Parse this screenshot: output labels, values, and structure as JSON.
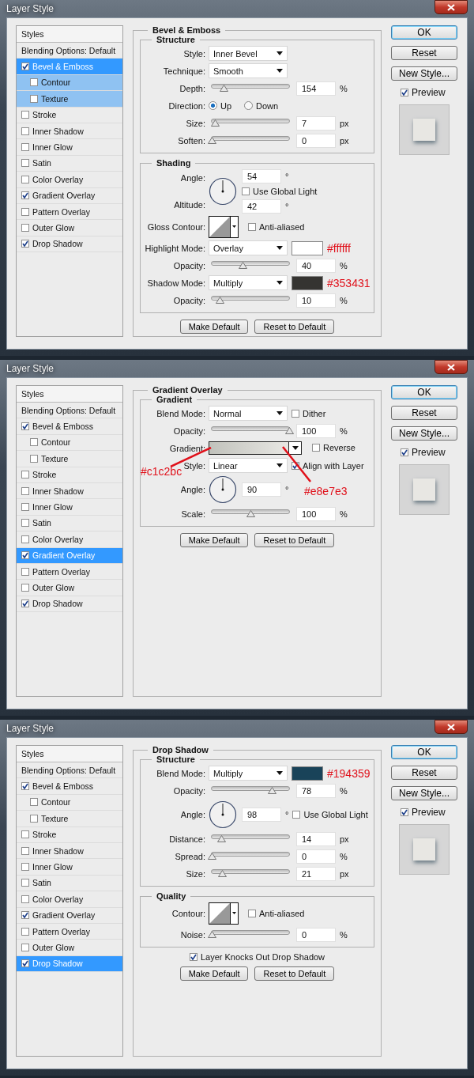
{
  "dialogs": [
    {
      "title": "Layer Style",
      "styles_header": "Styles",
      "styles": [
        {
          "label": "Blending Options: Default",
          "kind": "header",
          "selected": false
        },
        {
          "label": "Bevel & Emboss",
          "kind": "effect",
          "checked": true,
          "selected": true,
          "children": [
            {
              "label": "Contour",
              "checked": false
            },
            {
              "label": "Texture",
              "checked": false
            }
          ]
        },
        {
          "label": "Stroke",
          "kind": "effect",
          "checked": false,
          "selected": false
        },
        {
          "label": "Inner Shadow",
          "kind": "effect",
          "checked": false,
          "selected": false
        },
        {
          "label": "Inner Glow",
          "kind": "effect",
          "checked": false,
          "selected": false
        },
        {
          "label": "Satin",
          "kind": "effect",
          "checked": false,
          "selected": false
        },
        {
          "label": "Color Overlay",
          "kind": "effect",
          "checked": false,
          "selected": false
        },
        {
          "label": "Gradient Overlay",
          "kind": "effect",
          "checked": true,
          "selected": false
        },
        {
          "label": "Pattern Overlay",
          "kind": "effect",
          "checked": false,
          "selected": false
        },
        {
          "label": "Outer Glow",
          "kind": "effect",
          "checked": false,
          "selected": false
        },
        {
          "label": "Drop Shadow",
          "kind": "effect",
          "checked": true,
          "selected": false
        }
      ],
      "panel": {
        "title": "Bevel & Emboss",
        "groups": [
          {
            "title": "Structure",
            "rows": [
              {
                "kind": "select",
                "label": "Style:",
                "value": "Inner Bevel"
              },
              {
                "kind": "select",
                "label": "Technique:",
                "value": "Smooth"
              },
              {
                "kind": "slider",
                "label": "Depth:",
                "level": 0.15,
                "value": "154",
                "unit": "%"
              },
              {
                "kind": "radio",
                "label": "Direction:",
                "options": [
                  {
                    "label": "Up",
                    "selected": true
                  },
                  {
                    "label": "Down",
                    "selected": false
                  }
                ]
              },
              {
                "kind": "slider",
                "label": "Size:",
                "level": 0.04,
                "value": "7",
                "unit": "px"
              },
              {
                "kind": "slider",
                "label": "Soften:",
                "level": 0,
                "value": "0",
                "unit": "px"
              }
            ]
          },
          {
            "title": "Shading",
            "rows": [
              {
                "kind": "angle",
                "label": "Angle:",
                "value": "54",
                "unit": "°",
                "checkbox": {
                  "label": "Use Global Light",
                  "checked": false
                },
                "altitude": {
                  "label": "Altitude:",
                  "value": "42",
                  "unit": "°"
                }
              },
              {
                "kind": "contour",
                "label": "Gloss Contour:",
                "checkbox": {
                  "label": "Anti-aliased",
                  "checked": false
                }
              },
              {
                "kind": "select",
                "label": "Highlight Mode:",
                "value": "Overlay",
                "color": "#ffffff",
                "note": "#ffffff"
              },
              {
                "kind": "slider",
                "label": "Opacity:",
                "level": 0.4,
                "value": "40",
                "unit": "%"
              },
              {
                "kind": "select",
                "label": "Shadow Mode:",
                "value": "Multiply",
                "color": "#353431",
                "note": "#353431"
              },
              {
                "kind": "slider",
                "label": "Opacity:",
                "level": 0.1,
                "value": "10",
                "unit": "%"
              }
            ]
          }
        ],
        "buttons": [
          "Make Default",
          "Reset to Default"
        ]
      },
      "actions": [
        {
          "label": "OK",
          "default": true
        },
        {
          "label": "Reset",
          "default": false
        },
        {
          "label": "New Style...",
          "default": false
        }
      ],
      "preview": {
        "label": "Preview",
        "checked": true
      }
    },
    {
      "title": "Layer Style",
      "styles_header": "Styles",
      "styles": [
        {
          "label": "Blending Options: Default",
          "kind": "header",
          "selected": false
        },
        {
          "label": "Bevel & Emboss",
          "kind": "effect",
          "checked": true,
          "selected": false,
          "children": [
            {
              "label": "Contour",
              "checked": false
            },
            {
              "label": "Texture",
              "checked": false
            }
          ]
        },
        {
          "label": "Stroke",
          "kind": "effect",
          "checked": false,
          "selected": false
        },
        {
          "label": "Inner Shadow",
          "kind": "effect",
          "checked": false,
          "selected": false
        },
        {
          "label": "Inner Glow",
          "kind": "effect",
          "checked": false,
          "selected": false
        },
        {
          "label": "Satin",
          "kind": "effect",
          "checked": false,
          "selected": false
        },
        {
          "label": "Color Overlay",
          "kind": "effect",
          "checked": false,
          "selected": false
        },
        {
          "label": "Gradient Overlay",
          "kind": "effect",
          "checked": true,
          "selected": true
        },
        {
          "label": "Pattern Overlay",
          "kind": "effect",
          "checked": false,
          "selected": false
        },
        {
          "label": "Outer Glow",
          "kind": "effect",
          "checked": false,
          "selected": false
        },
        {
          "label": "Drop Shadow",
          "kind": "effect",
          "checked": true,
          "selected": false
        }
      ],
      "panel": {
        "title": "Gradient Overlay",
        "groups": [
          {
            "title": "Gradient",
            "rows": [
              {
                "kind": "select",
                "label": "Blend Mode:",
                "value": "Normal",
                "checkbox": {
                  "label": "Dither",
                  "checked": false
                }
              },
              {
                "kind": "slider",
                "label": "Opacity:",
                "level": 1,
                "value": "100",
                "unit": "%"
              },
              {
                "kind": "gradient",
                "label": "Gradient:",
                "stops": [
                  {
                    "color": "#c1c2bc",
                    "note": "#c1c2bc"
                  },
                  {
                    "color": "#e8e7e3",
                    "note": "#e8e7e3"
                  }
                ],
                "checkbox": {
                  "label": "Reverse",
                  "checked": false
                }
              },
              {
                "kind": "select",
                "label": "Style:",
                "value": "Linear",
                "checkbox": {
                  "label": "Align with Layer",
                  "checked": true
                }
              },
              {
                "kind": "angle",
                "label": "Angle:",
                "value": "90",
                "unit": "°"
              },
              {
                "kind": "slider",
                "label": "Scale:",
                "level": 0.5,
                "value": "100",
                "unit": "%"
              }
            ]
          }
        ],
        "buttons": [
          "Make Default",
          "Reset to Default"
        ]
      },
      "actions": [
        {
          "label": "OK",
          "default": true
        },
        {
          "label": "Reset",
          "default": false
        },
        {
          "label": "New Style...",
          "default": false
        }
      ],
      "preview": {
        "label": "Preview",
        "checked": true
      }
    },
    {
      "title": "Layer Style",
      "styles_header": "Styles",
      "styles": [
        {
          "label": "Blending Options: Default",
          "kind": "header",
          "selected": false
        },
        {
          "label": "Bevel & Emboss",
          "kind": "effect",
          "checked": true,
          "selected": false,
          "children": [
            {
              "label": "Contour",
              "checked": false
            },
            {
              "label": "Texture",
              "checked": false
            }
          ]
        },
        {
          "label": "Stroke",
          "kind": "effect",
          "checked": false,
          "selected": false
        },
        {
          "label": "Inner Shadow",
          "kind": "effect",
          "checked": false,
          "selected": false
        },
        {
          "label": "Inner Glow",
          "kind": "effect",
          "checked": false,
          "selected": false
        },
        {
          "label": "Satin",
          "kind": "effect",
          "checked": false,
          "selected": false
        },
        {
          "label": "Color Overlay",
          "kind": "effect",
          "checked": false,
          "selected": false
        },
        {
          "label": "Gradient Overlay",
          "kind": "effect",
          "checked": true,
          "selected": false
        },
        {
          "label": "Pattern Overlay",
          "kind": "effect",
          "checked": false,
          "selected": false
        },
        {
          "label": "Outer Glow",
          "kind": "effect",
          "checked": false,
          "selected": false
        },
        {
          "label": "Drop Shadow",
          "kind": "effect",
          "checked": true,
          "selected": true
        }
      ],
      "panel": {
        "title": "Drop Shadow",
        "groups": [
          {
            "title": "Structure",
            "rows": [
              {
                "kind": "select",
                "label": "Blend Mode:",
                "value": "Multiply",
                "color": "#194359",
                "note": "#194359"
              },
              {
                "kind": "slider",
                "label": "Opacity:",
                "level": 0.78,
                "value": "78",
                "unit": "%"
              },
              {
                "kind": "angle",
                "label": "Angle:",
                "value": "98",
                "unit": "°",
                "checkbox": {
                  "label": "Use Global Light",
                  "checked": false
                }
              },
              {
                "kind": "slider",
                "label": "Distance:",
                "level": 0.12,
                "value": "14",
                "unit": "px"
              },
              {
                "kind": "slider",
                "label": "Spread:",
                "level": 0,
                "value": "0",
                "unit": "%"
              },
              {
                "kind": "slider",
                "label": "Size:",
                "level": 0.13,
                "value": "21",
                "unit": "px"
              }
            ]
          },
          {
            "title": "Quality",
            "rows": [
              {
                "kind": "contour",
                "label": "Contour:",
                "checkbox": {
                  "label": "Anti-aliased",
                  "checked": false
                }
              },
              {
                "kind": "slider",
                "label": "Noise:",
                "level": 0,
                "value": "0",
                "unit": "%"
              }
            ]
          }
        ],
        "footer_checkbox": {
          "label": "Layer Knocks Out Drop Shadow",
          "checked": true
        },
        "buttons": [
          "Make Default",
          "Reset to Default"
        ]
      },
      "actions": [
        {
          "label": "OK",
          "default": true
        },
        {
          "label": "Reset",
          "default": false
        },
        {
          "label": "New Style...",
          "default": false
        }
      ],
      "preview": {
        "label": "Preview",
        "checked": true
      }
    }
  ]
}
